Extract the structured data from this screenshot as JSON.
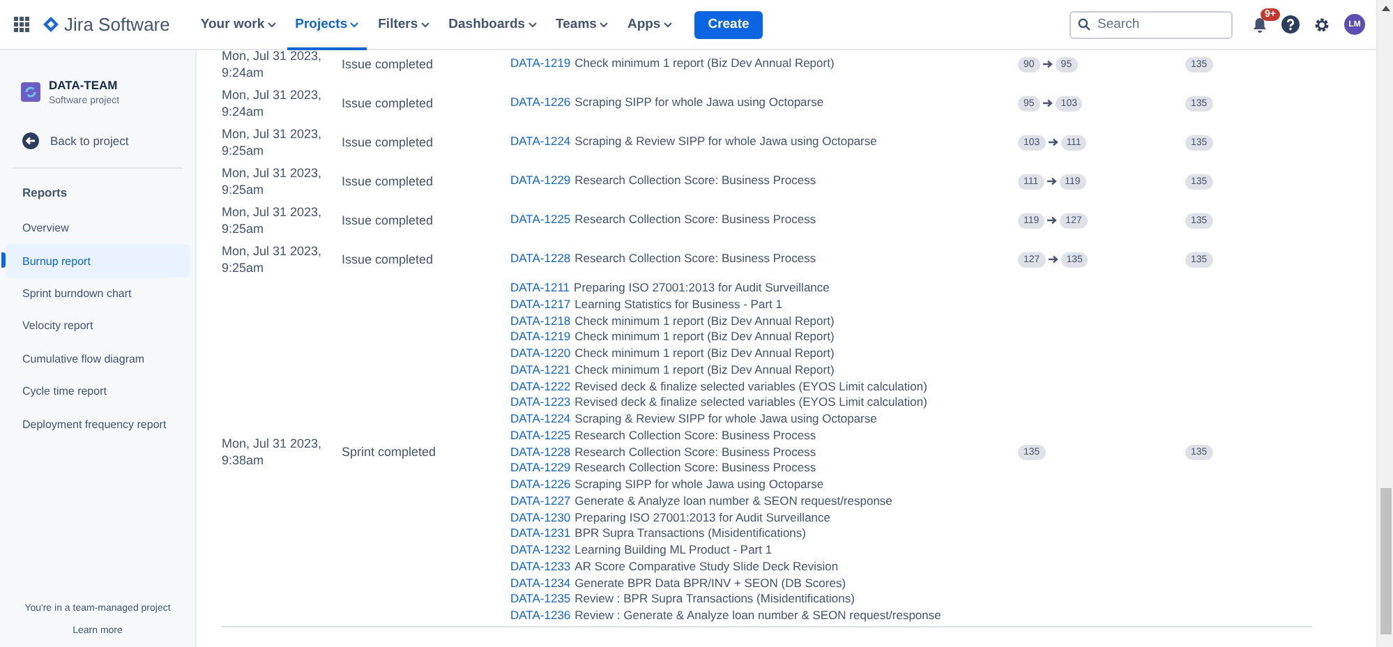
{
  "topbar": {
    "product": "Jira Software",
    "nav": [
      {
        "label": "Your work",
        "selected": false
      },
      {
        "label": "Projects",
        "selected": true
      },
      {
        "label": "Filters",
        "selected": false
      },
      {
        "label": "Dashboards",
        "selected": false
      },
      {
        "label": "Teams",
        "selected": false
      },
      {
        "label": "Apps",
        "selected": false
      }
    ],
    "create": "Create",
    "search": {
      "placeholder": "Search"
    },
    "notifications": "9+",
    "avatar": "LM"
  },
  "sidebar": {
    "project": {
      "name": "DATA-TEAM",
      "type": "Software project"
    },
    "back": "Back to project",
    "section": "Reports",
    "items": [
      {
        "label": "Overview",
        "selected": false
      },
      {
        "label": "Burnup report",
        "selected": true
      },
      {
        "label": "Sprint burndown chart",
        "selected": false
      },
      {
        "label": "Velocity report",
        "selected": false
      },
      {
        "label": "Cumulative flow diagram",
        "selected": false
      },
      {
        "label": "Cycle time report",
        "selected": false
      },
      {
        "label": "Deployment frequency report",
        "selected": false
      }
    ],
    "footer": "You're in a team-managed project",
    "learn_more": "Learn more"
  },
  "table": {
    "rows": [
      {
        "date": "Mon, Jul 31 2023, 9:24am",
        "event": "Issue completed",
        "issues": [
          {
            "key": "DATA-1219",
            "summary": "Check minimum 1 report (Biz Dev Annual Report)"
          }
        ],
        "scope": {
          "kind": "change",
          "from": "90",
          "to": "95"
        },
        "completed": "135"
      },
      {
        "date": "Mon, Jul 31 2023, 9:24am",
        "event": "Issue completed",
        "issues": [
          {
            "key": "DATA-1226",
            "summary": "Scraping SIPP for whole Jawa using Octoparse"
          }
        ],
        "scope": {
          "kind": "change",
          "from": "95",
          "to": "103"
        },
        "completed": "135"
      },
      {
        "date": "Mon, Jul 31 2023, 9:25am",
        "event": "Issue completed",
        "issues": [
          {
            "key": "DATA-1224",
            "summary": "Scraping & Review SIPP for whole Jawa using Octoparse"
          }
        ],
        "scope": {
          "kind": "change",
          "from": "103",
          "to": "111"
        },
        "completed": "135"
      },
      {
        "date": "Mon, Jul 31 2023, 9:25am",
        "event": "Issue completed",
        "issues": [
          {
            "key": "DATA-1229",
            "summary": "Research Collection Score: Business Process"
          }
        ],
        "scope": {
          "kind": "change",
          "from": "111",
          "to": "119"
        },
        "completed": "135"
      },
      {
        "date": "Mon, Jul 31 2023, 9:25am",
        "event": "Issue completed",
        "issues": [
          {
            "key": "DATA-1225",
            "summary": "Research Collection Score: Business Process"
          }
        ],
        "scope": {
          "kind": "change",
          "from": "119",
          "to": "127"
        },
        "completed": "135"
      },
      {
        "date": "Mon, Jul 31 2023, 9:25am",
        "event": "Issue completed",
        "issues": [
          {
            "key": "DATA-1228",
            "summary": "Research Collection Score: Business Process"
          }
        ],
        "scope": {
          "kind": "change",
          "from": "127",
          "to": "135"
        },
        "completed": "135"
      },
      {
        "date": "Mon, Jul 31 2023, 9:38am",
        "event": "Sprint completed",
        "issues": [
          {
            "key": "DATA-1211",
            "summary": "Preparing ISO 27001:2013 for Audit Surveillance"
          },
          {
            "key": "DATA-1217",
            "summary": "Learning Statistics for Business - Part 1"
          },
          {
            "key": "DATA-1218",
            "summary": "Check minimum 1 report (Biz Dev Annual Report)"
          },
          {
            "key": "DATA-1219",
            "summary": "Check minimum 1 report (Biz Dev Annual Report)"
          },
          {
            "key": "DATA-1220",
            "summary": "Check minimum 1 report (Biz Dev Annual Report)"
          },
          {
            "key": "DATA-1221",
            "summary": "Check minimum 1 report (Biz Dev Annual Report)"
          },
          {
            "key": "DATA-1222",
            "summary": "Revised deck & finalize selected variables (EYOS Limit calculation)"
          },
          {
            "key": "DATA-1223",
            "summary": "Revised deck & finalize selected variables (EYOS Limit calculation)"
          },
          {
            "key": "DATA-1224",
            "summary": "Scraping & Review SIPP for whole Jawa using Octoparse"
          },
          {
            "key": "DATA-1225",
            "summary": "Research Collection Score: Business Process"
          },
          {
            "key": "DATA-1228",
            "summary": "Research Collection Score: Business Process"
          },
          {
            "key": "DATA-1229",
            "summary": "Research Collection Score: Business Process"
          },
          {
            "key": "DATA-1226",
            "summary": "Scraping SIPP for whole Jawa using Octoparse"
          },
          {
            "key": "DATA-1227",
            "summary": "Generate & Analyze loan number & SEON request/response"
          },
          {
            "key": "DATA-1230",
            "summary": "Preparing ISO 27001:2013 for Audit Surveillance"
          },
          {
            "key": "DATA-1231",
            "summary": "BPR Supra Transactions (Misidentifications)"
          },
          {
            "key": "DATA-1232",
            "summary": "Learning Building ML Product - Part 1"
          },
          {
            "key": "DATA-1233",
            "summary": "AR Score Comparative Study Slide Deck Revision"
          },
          {
            "key": "DATA-1234",
            "summary": "Generate BPR Data BPR/INV + SEON (DB Scores)"
          },
          {
            "key": "DATA-1235",
            "summary": "Review : BPR Supra Transactions (Misidentifications)"
          },
          {
            "key": "DATA-1236",
            "summary": "Review : Generate & Analyze loan number & SEON request/response"
          }
        ],
        "scope": {
          "kind": "value",
          "value": "135"
        },
        "completed": "135"
      }
    ]
  }
}
